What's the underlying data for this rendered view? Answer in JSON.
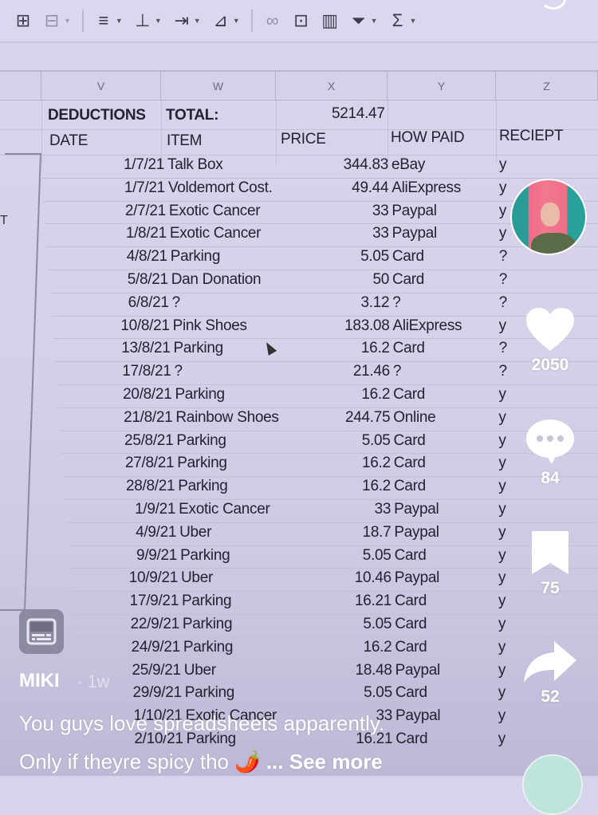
{
  "toolbar": {
    "items": [
      {
        "icon": "insert-table-icon",
        "caret": false
      },
      {
        "icon": "merge-cells-icon",
        "caret": true,
        "faded": true
      },
      {
        "icon": "horizontal-align-icon",
        "caret": true
      },
      {
        "icon": "vertical-align-icon",
        "caret": true
      },
      {
        "icon": "text-wrap-icon",
        "caret": true
      },
      {
        "icon": "text-rotation-icon",
        "caret": true
      },
      {
        "icon": "link-icon",
        "caret": false,
        "faded": true
      },
      {
        "icon": "insert-comment-icon",
        "caret": false
      },
      {
        "icon": "insert-chart-icon",
        "caret": false
      },
      {
        "icon": "filter-icon",
        "caret": true
      },
      {
        "icon": "functions-icon",
        "caret": true
      }
    ]
  },
  "sheet": {
    "columns": [
      "V",
      "W",
      "X",
      "Y",
      "Z"
    ],
    "summary": {
      "label1": "DEDUCTIONS",
      "label2": "TOTAL:",
      "total": "5214.47"
    },
    "headers": {
      "date": "DATE",
      "item": "ITEM",
      "price": "PRICE",
      "how_paid": "HOW PAID",
      "receipt": "RECIEPT"
    },
    "left_panel_text": "T",
    "rows": [
      {
        "date": "1/7/21",
        "item": "Talk Box",
        "price": "344.83",
        "paid": "eBay",
        "receipt": "y"
      },
      {
        "date": "1/7/21",
        "item": "Voldemort Cost.",
        "price": "49.44",
        "paid": "AliExpress",
        "receipt": "y"
      },
      {
        "date": "2/7/21",
        "item": "Exotic Cancer",
        "price": "33",
        "paid": "Paypal",
        "receipt": "y"
      },
      {
        "date": "1/8/21",
        "item": "Exotic Cancer",
        "price": "33",
        "paid": "Paypal",
        "receipt": "y"
      },
      {
        "date": "4/8/21",
        "item": "Parking",
        "price": "5.05",
        "paid": "Card",
        "receipt": "?"
      },
      {
        "date": "5/8/21",
        "item": "Dan Donation",
        "price": "50",
        "paid": "Card",
        "receipt": "?"
      },
      {
        "date": "6/8/21",
        "item": "?",
        "price": "3.12",
        "paid": "?",
        "receipt": "?"
      },
      {
        "date": "10/8/21",
        "item": "Pink Shoes",
        "price": "183.08",
        "paid": "AliExpress",
        "receipt": "y"
      },
      {
        "date": "13/8/21",
        "item": "Parking",
        "price": "16.2",
        "paid": "Card",
        "receipt": "?"
      },
      {
        "date": "17/8/21",
        "item": "?",
        "price": "21.46",
        "paid": "?",
        "receipt": "?"
      },
      {
        "date": "20/8/21",
        "item": "Parking",
        "price": "16.2",
        "paid": "Card",
        "receipt": "y"
      },
      {
        "date": "21/8/21",
        "item": "Rainbow Shoes",
        "price": "244.75",
        "paid": "Online",
        "receipt": "y"
      },
      {
        "date": "25/8/21",
        "item": "Parking",
        "price": "5.05",
        "paid": "Card",
        "receipt": "y"
      },
      {
        "date": "27/8/21",
        "item": "Parking",
        "price": "16.2",
        "paid": "Card",
        "receipt": "y"
      },
      {
        "date": "28/8/21",
        "item": "Parking",
        "price": "16.2",
        "paid": "Card",
        "receipt": "y"
      },
      {
        "date": "1/9/21",
        "item": "Exotic Cancer",
        "price": "33",
        "paid": "Paypal",
        "receipt": "y"
      },
      {
        "date": "4/9/21",
        "item": "Uber",
        "price": "18.7",
        "paid": "Paypal",
        "receipt": "y"
      },
      {
        "date": "9/9/21",
        "item": "Parking",
        "price": "5.05",
        "paid": "Card",
        "receipt": "y"
      },
      {
        "date": "10/9/21",
        "item": "Uber",
        "price": "10.46",
        "paid": "Paypal",
        "receipt": "y"
      },
      {
        "date": "17/9/21",
        "item": "Parking",
        "price": "16.21",
        "paid": "Card",
        "receipt": "y"
      },
      {
        "date": "22/9/21",
        "item": "Parking",
        "price": "5.05",
        "paid": "Card",
        "receipt": "y"
      },
      {
        "date": "24/9/21",
        "item": "Parking",
        "price": "16.2",
        "paid": "Card",
        "receipt": "y"
      },
      {
        "date": "25/9/21",
        "item": "Uber",
        "price": "18.48",
        "paid": "Paypal",
        "receipt": "y"
      },
      {
        "date": "29/9/21",
        "item": "Parking",
        "price": "5.05",
        "paid": "Card",
        "receipt": "y"
      },
      {
        "date": "1/10/21",
        "item": "Exotic Cancer",
        "price": "33",
        "paid": "Paypal",
        "receipt": "y"
      },
      {
        "date": "2/10/21",
        "item": "Parking",
        "price": "16.21",
        "paid": "Card",
        "receipt": "y"
      }
    ]
  },
  "tiktok": {
    "likes": "2050",
    "comments": "84",
    "saves": "75",
    "shares": "52",
    "username": "MIKI",
    "time": "· 1w",
    "description_line1": "You guys love spreadsheets apparently.",
    "description_line2": "Only if theyre spicy tho 🌶️",
    "see_more": "... See more"
  }
}
